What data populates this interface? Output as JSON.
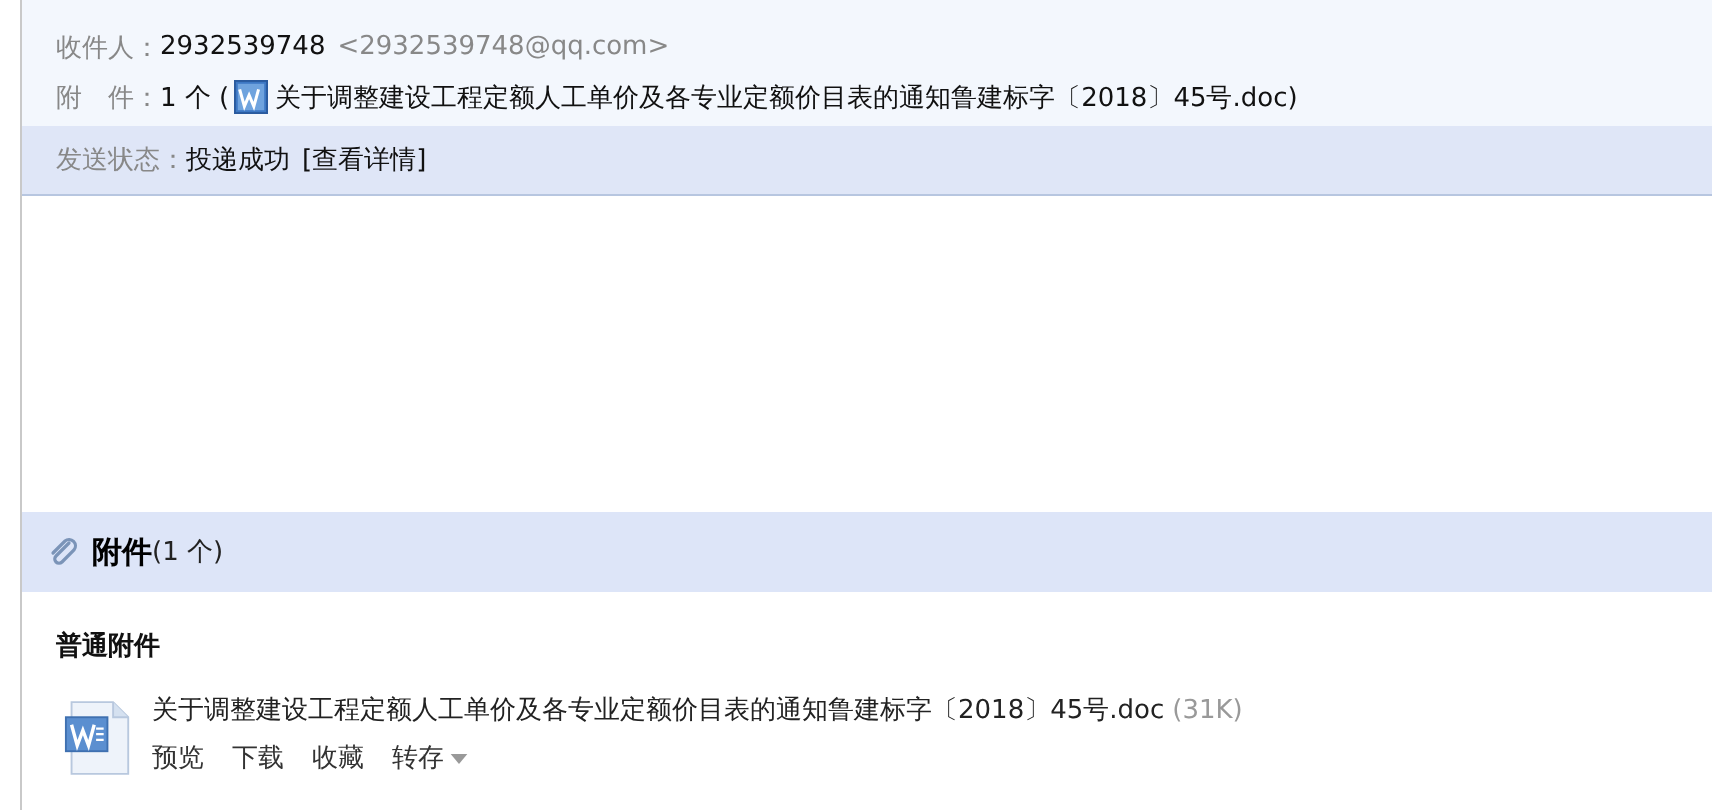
{
  "header": {
    "recipient": {
      "label": "收件人：",
      "name": "2932539748",
      "address": "<2932539748@qq.com>"
    },
    "attachment": {
      "label": "附　件：",
      "count": "1 个 (",
      "file": "关于调整建设工程定额人工单价及各专业定额价目表的通知鲁建标字〔2018〕45号.doc)"
    }
  },
  "status": {
    "label": "发送状态：",
    "value": "投递成功",
    "link": "[查看详情]"
  },
  "attachments": {
    "title": "附件",
    "count": "(1 个)",
    "group": "普通附件",
    "files": [
      {
        "name": "关于调整建设工程定额人工单价及各专业定额价目表的通知鲁建标字〔2018〕45号.doc",
        "size": "(31K)",
        "actions": [
          {
            "label": "预览",
            "dropdown": false
          },
          {
            "label": "下载",
            "dropdown": false
          },
          {
            "label": "收藏",
            "dropdown": false
          },
          {
            "label": "转存",
            "dropdown": true
          }
        ]
      }
    ]
  }
}
